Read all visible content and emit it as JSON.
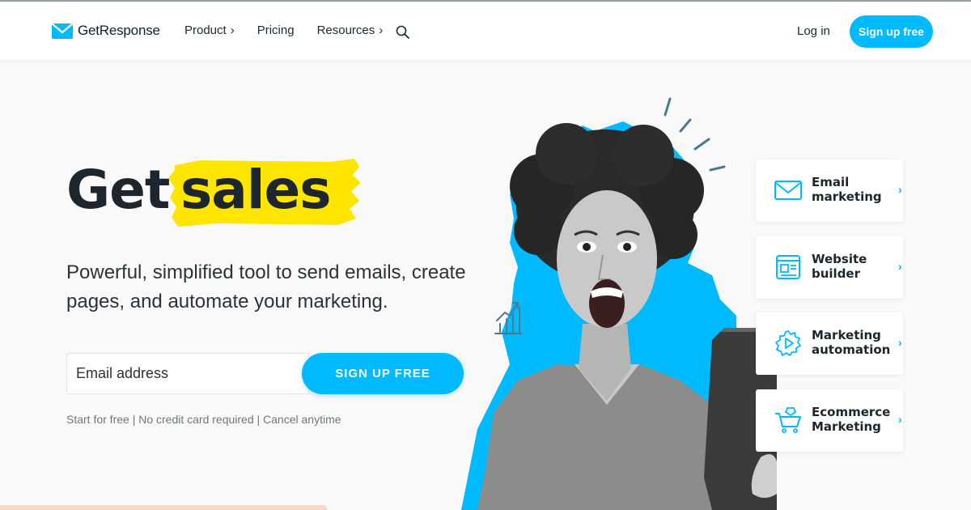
{
  "header": {
    "logo_text": "GetResponse",
    "nav": [
      {
        "label": "Product",
        "chevron": "›"
      },
      {
        "label": "Pricing",
        "chevron": ""
      },
      {
        "label": "Resources",
        "chevron": "›"
      }
    ],
    "login": "Log in",
    "signup": "Sign up free"
  },
  "hero": {
    "headline_1": "Get",
    "headline_2": "sales",
    "subtitle": "Powerful, simplified tool to send emails, create pages, and automate your marketing.",
    "email_placeholder": "Email address",
    "cta": "SIGN UP FREE",
    "disclaimer": "Start for free | No credit card required | Cancel anytime"
  },
  "features": [
    {
      "label": "Email marketing",
      "icon": "envelope-icon"
    },
    {
      "label": "Website builder",
      "icon": "website-icon"
    },
    {
      "label": "Marketing automation",
      "icon": "gear-play-icon"
    },
    {
      "label": "Ecommerce Marketing",
      "icon": "cart-icon"
    }
  ],
  "colors": {
    "accent": "#00baff",
    "highlight": "#ffe500",
    "text": "#1d262c"
  }
}
